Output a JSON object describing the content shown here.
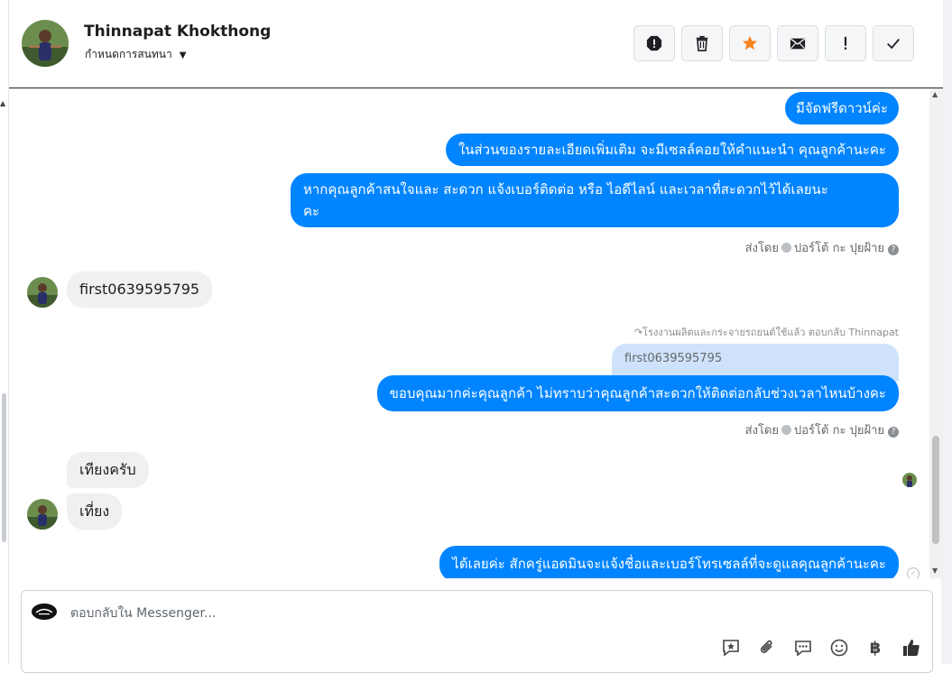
{
  "header": {
    "name": "Thinnapat Khokthong",
    "assign_label": "กำหนดการสนทนา"
  },
  "actions": [
    {
      "id": "spam",
      "icon": "stop-alert-icon"
    },
    {
      "id": "delete",
      "icon": "trash-icon"
    },
    {
      "id": "star",
      "icon": "star-icon",
      "color": "#f5821f"
    },
    {
      "id": "email",
      "icon": "envelope-icon"
    },
    {
      "id": "follow",
      "icon": "exclamation-icon"
    },
    {
      "id": "done",
      "icon": "checkmark-icon"
    }
  ],
  "messages": {
    "out1": "มีจัดฟรีดาวน์ค่ะ",
    "out2": "ในส่วนของรายละเอียดเพิ่มเติม จะมีเซลล์คอยให้คำแนะนำ คุณลูกค้านะคะ",
    "out3_line1": "หากคุณลูกค้าสนใจและ สะดวก แจ้งเบอร์ติดต่อ หรือ ไอดีไลน์ และเวลาที่สะดวกไว้ได้เลยนะ",
    "out3_line2": "คะ",
    "sent_by_prefix": "ส่งโดย",
    "sent_by_name": "ปอร์โต้ กะ ปุยฝ้าย",
    "in1": "first0639595795",
    "reply_note": "โรงงานผลิตและกระจายรถยนต์ใช้แล้ว ตอบกลับ Thinnapat",
    "quoted": "first0639595795",
    "out4": "ขอบคุณมากค่ะคุณลูกค้า ไม่ทราบว่าคุณลูกค้าสะดวกให้ติดต่อกลับช่วงเวลาไหนบ้างคะ",
    "in2": "เทียงครับ",
    "in3": "เที่ยง",
    "out5": "ได้เลยค่ะ สักครู่แอดมินจะแจ้งชื่อและเบอร์โทรเซลล์ที่จะดูแลคุณลูกค้านะคะ"
  },
  "composer": {
    "placeholder": "ตอบกลับใน Messenger..."
  },
  "tools": {
    "baht_symbol": "฿"
  },
  "colors": {
    "accent": "#0084ff",
    "incoming": "#f0f0f0",
    "star": "#f5821f"
  }
}
